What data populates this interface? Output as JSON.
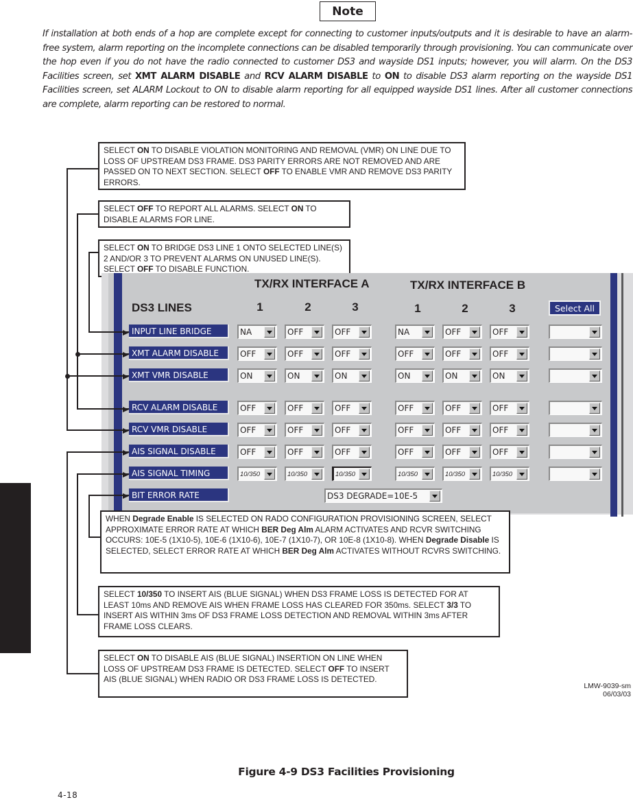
{
  "note": {
    "title": "Note",
    "segments": [
      {
        "t": "If installation at both ends of a hop are complete except for connecting to customer inputs/outputs and it is desirable to have an alarm-free system, alarm reporting on the incomplete connections can be disabled temporarily through provisioning. You can communicate over the hop even if you do not have the radio connected to customer DS3 and wayside DS1 inputs; however, you will alarm. On the DS3 Facilities screen, set ",
        "b": false
      },
      {
        "t": "XMT ALARM DISABLE",
        "b": true
      },
      {
        "t": " and ",
        "b": false
      },
      {
        "t": "RCV ALARM DISABLE",
        "b": true
      },
      {
        "t": " to ",
        "b": false
      },
      {
        "t": "ON",
        "b": true
      },
      {
        "t": " to disable DS3 alarm reporting on the wayside DS1 Facilities screen, set ALARM Lockout to ON to disable alarm reporting for all equipped wayside DS1 lines. After all customer connections are complete, alarm reporting can be restored to normal.",
        "b": false
      }
    ]
  },
  "callouts": [
    {
      "id": "vmr",
      "segments": [
        {
          "t": "SELECT "
        },
        {
          "t": "ON",
          "b": true
        },
        {
          "t": " TO DISABLE VIOLATION MONITORING AND REMOVAL (VMR) ON LINE DUE TO LOSS OF UPSTREAM DS3 FRAME. DS3 PARITY ERRORS ARE NOT REMOVED AND ARE PASSED ON TO NEXT SECTION. SELECT "
        },
        {
          "t": "OFF",
          "b": true
        },
        {
          "t": " TO ENABLE VMR AND REMOVE DS3 PARITY ERRORS."
        }
      ]
    },
    {
      "id": "alarm",
      "segments": [
        {
          "t": "SELECT "
        },
        {
          "t": "OFF",
          "b": true
        },
        {
          "t": " TO REPORT ALL ALARMS. SELECT "
        },
        {
          "t": "ON",
          "b": true
        },
        {
          "t": " TO DISABLE ALARMS FOR LINE."
        }
      ]
    },
    {
      "id": "bridge",
      "segments": [
        {
          "t": "SELECT "
        },
        {
          "t": "ON",
          "b": true
        },
        {
          "t": " TO BRIDGE DS3 LINE 1 ONTO SELECTED LINE(S) 2 AND/OR 3 TO PREVENT ALARMS ON UNUSED LINE(S). SELECT "
        },
        {
          "t": "OFF",
          "b": true
        },
        {
          "t": " TO DISABLE FUNCTION."
        }
      ]
    },
    {
      "id": "ber",
      "segments": [
        {
          "t": "WHEN "
        },
        {
          "t": "Degrade Enable",
          "b": true
        },
        {
          "t": " IS SELECTED ON RADO CONFIGURATION PROVISIONING SCREEN, SELECT APPROXIMATE ERROR RATE AT WHICH "
        },
        {
          "t": "BER Deg Alm",
          "b": true
        },
        {
          "t": " ALARM ACTIVATES AND RCVR SWITCHING OCCURS: 10E-5 (1X10-5), 10E-6 (1X10-6), 10E-7 (1X10-7), OR 10E-8 (1X10-8). WHEN "
        },
        {
          "t": "Degrade Disable",
          "b": true
        },
        {
          "t": " IS SELECTED, SELECT ERROR RATE AT WHICH "
        },
        {
          "t": "BER Deg Alm",
          "b": true
        },
        {
          "t": " ACTIVATES WITHOUT RCVRS SWITCHING."
        }
      ]
    },
    {
      "id": "timing",
      "segments": [
        {
          "t": "SELECT "
        },
        {
          "t": "10/350",
          "b": true
        },
        {
          "t": " TO INSERT AIS (BLUE SIGNAL) WHEN DS3 FRAME LOSS IS DETECTED FOR AT LEAST 10ms AND REMOVE AIS WHEN FRAME LOSS HAS CLEARED FOR 350ms. SELECT "
        },
        {
          "t": "3/3",
          "b": true
        },
        {
          "t": " TO INSERT AIS WITHIN 3ms OF DS3 FRAME LOSS DETECTION AND REMOVAL WITHIN 3ms AFTER FRAME LOSS CLEARS."
        }
      ]
    },
    {
      "id": "ais",
      "segments": [
        {
          "t": "SELECT "
        },
        {
          "t": "ON",
          "b": true
        },
        {
          "t": " TO DISABLE AIS (BLUE SIGNAL) INSERTION ON LINE WHEN LOSS OF UPSTREAM DS3 FRAME IS DETECTED. SELECT "
        },
        {
          "t": "OFF",
          "b": true
        },
        {
          "t": " TO INSERT AIS (BLUE SIGNAL) WHEN RADIO OR DS3 FRAME LOSS IS DETECTED."
        }
      ]
    }
  ],
  "panel": {
    "title": "DS3 LINES",
    "interface_a": "TX/RX INTERFACE A",
    "interface_b": "TX/RX INTERFACE B",
    "col_numbers": [
      "1",
      "2",
      "3",
      "1",
      "2",
      "3"
    ],
    "select_all": "Select All",
    "rows": [
      {
        "label": "INPUT LINE BRIDGE",
        "values": [
          "NA",
          "OFF",
          "OFF",
          "NA",
          "OFF",
          "OFF"
        ],
        "all": ""
      },
      {
        "label": "XMT ALARM DISABLE",
        "values": [
          "OFF",
          "OFF",
          "OFF",
          "OFF",
          "OFF",
          "OFF"
        ],
        "all": ""
      },
      {
        "label": "XMT VMR DISABLE",
        "values": [
          "ON",
          "ON",
          "ON",
          "ON",
          "ON",
          "ON"
        ],
        "all": ""
      },
      {
        "label": "RCV ALARM DISABLE",
        "values": [
          "OFF",
          "OFF",
          "OFF",
          "OFF",
          "OFF",
          "OFF"
        ],
        "all": ""
      },
      {
        "label": "RCV VMR DISABLE",
        "values": [
          "OFF",
          "OFF",
          "OFF",
          "OFF",
          "OFF",
          "OFF"
        ],
        "all": ""
      },
      {
        "label": "AIS SIGNAL DISABLE",
        "values": [
          "OFF",
          "OFF",
          "OFF",
          "OFF",
          "OFF",
          "OFF"
        ],
        "all": ""
      },
      {
        "label": "AIS SIGNAL TIMING",
        "values": [
          "10/350",
          "10/350",
          "10/350",
          "10/350",
          "10/350",
          "10/350"
        ],
        "all": ""
      },
      {
        "label": "BIT ERROR RATE",
        "values": [],
        "all": null
      }
    ],
    "ber_value": "DS3 DEGRADE=10E-5"
  },
  "lmw": {
    "code": "LMW-9039-sm",
    "date": "06/03/03"
  },
  "figure_caption": "Figure 4-9   DS3 Facilities Provisioning",
  "page_number": "4-18"
}
